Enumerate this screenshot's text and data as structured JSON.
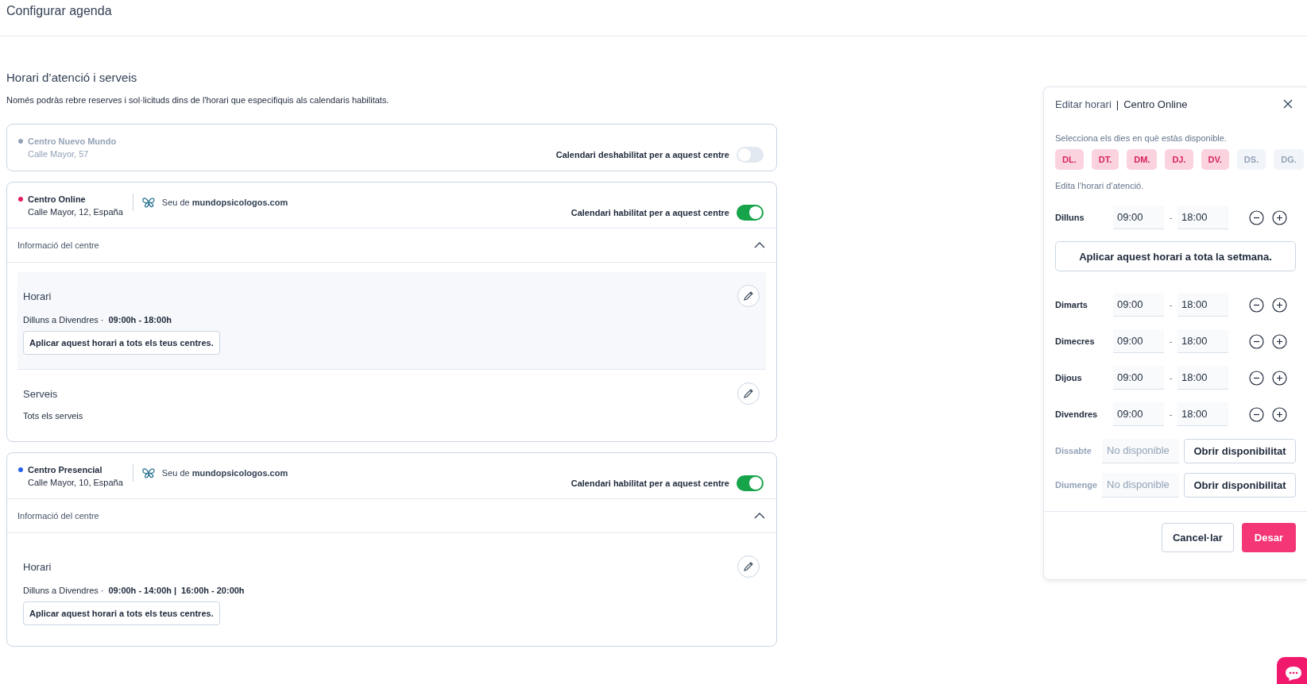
{
  "page_title": "Configurar agenda",
  "section": {
    "title": "Horari d’atenció i serveis",
    "description": "Només podràs rebre reserves i sol·licituds dins de l'horari que especifiquis als calendaris habilitats."
  },
  "centers": [
    {
      "name": "Centro Nuevo Mundo",
      "address": "Calle Mayor, 57",
      "color": "#94a3b8",
      "enabled": false,
      "toggle_label": "Calendari deshabilitat per a aquest centre"
    },
    {
      "name": "Centro Online",
      "address": "Calle Mayor, 12, España",
      "color": "#e11d63",
      "enabled": true,
      "site": {
        "prefix": "Seu de",
        "domain": "mundopsicologos.com"
      },
      "toggle_label": "Calendari habilitat per a aquest centre",
      "info": {
        "label": "Informació del centre",
        "expanded": true,
        "sections": [
          {
            "kind": "schedule",
            "highlighted": true,
            "title": "Horari",
            "days": "Dilluns a Divendres ·",
            "hours": [
              "09:00h - 18:00h"
            ],
            "apply_button": "Aplicar aquest horari a tots els teus centres."
          },
          {
            "kind": "services",
            "highlighted": false,
            "title": "Serveis",
            "text": "Tots els serveis"
          }
        ]
      }
    },
    {
      "name": "Centro Presencial",
      "address": "Calle Mayor, 10, España",
      "color": "#2563eb",
      "enabled": true,
      "site": {
        "prefix": "Seu de",
        "domain": "mundopsicologos.com"
      },
      "toggle_label": "Calendari habilitat per a aquest centre",
      "info": {
        "label": "Informació del centre",
        "expanded": true,
        "sections": [
          {
            "kind": "schedule",
            "highlighted": false,
            "title": "Horari",
            "days": "Dilluns a Divendres ·",
            "hours": [
              "09:00h - 14:00h |",
              "16:00h - 20:00h"
            ],
            "apply_button": "Aplicar aquest horari a tots els teus centres."
          }
        ]
      }
    }
  ],
  "panel": {
    "title": "Editar horari",
    "separator": "|",
    "center": "Centro Online",
    "days_prompt": "Selecciona els dies en què estàs disponible.",
    "days": [
      {
        "label": "DL.",
        "selected": true
      },
      {
        "label": "DT.",
        "selected": true
      },
      {
        "label": "DM.",
        "selected": true
      },
      {
        "label": "DJ.",
        "selected": true
      },
      {
        "label": "DV.",
        "selected": true
      },
      {
        "label": "DS.",
        "selected": false
      },
      {
        "label": "DG.",
        "selected": false
      }
    ],
    "edit_prompt": "Edita l’horari d’atenció.",
    "rows": [
      {
        "kind": "hours",
        "day": "Dilluns",
        "from": "09:00",
        "dash": "-",
        "to": "18:00"
      },
      {
        "kind": "apply",
        "label": "Aplicar aquest horari a tota la setmana."
      },
      {
        "kind": "hours",
        "day": "Dimarts",
        "from": "09:00",
        "dash": "-",
        "to": "18:00"
      },
      {
        "kind": "hours",
        "day": "Dimecres",
        "from": "09:00",
        "dash": "-",
        "to": "18:00"
      },
      {
        "kind": "hours",
        "day": "Dijous",
        "from": "09:00",
        "dash": "-",
        "to": "18:00"
      },
      {
        "kind": "hours",
        "day": "Divendres",
        "from": "09:00",
        "dash": "-",
        "to": "18:00"
      },
      {
        "kind": "closed",
        "day": "Dissabte",
        "placeholder": "No disponible",
        "button": "Obrir disponibilitat"
      },
      {
        "kind": "closed",
        "day": "Diumenge",
        "placeholder": "No disponible",
        "button": "Obrir disponibilitat"
      }
    ],
    "cancel": "Cancel·lar",
    "save": "Desar"
  }
}
